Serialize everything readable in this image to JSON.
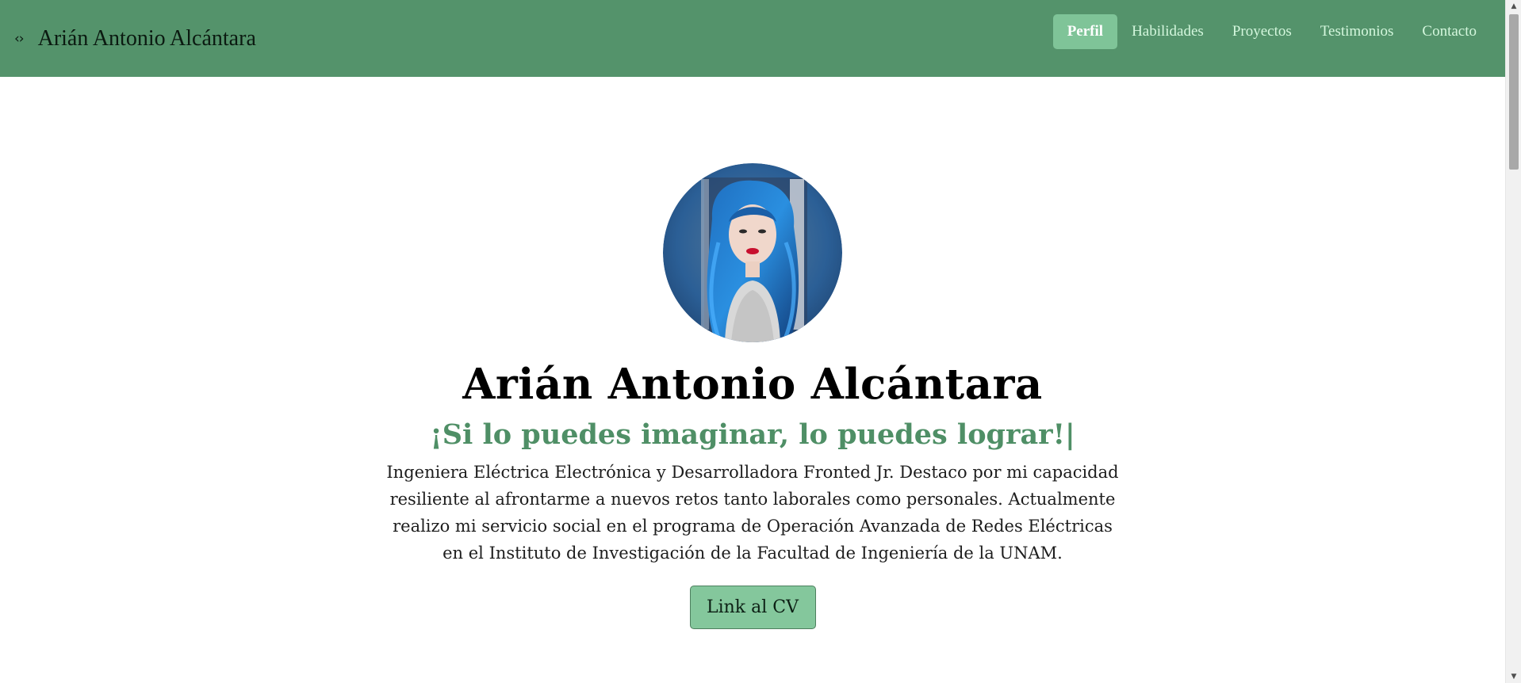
{
  "navbar": {
    "brand_icon": "‹›",
    "brand_name": "Arián Antonio Alcántara",
    "links": [
      {
        "label": "Perfil",
        "active": true
      },
      {
        "label": "Habilidades",
        "active": false
      },
      {
        "label": "Proyectos",
        "active": false
      },
      {
        "label": "Testimonios",
        "active": false
      },
      {
        "label": "Contacto",
        "active": false
      }
    ]
  },
  "hero": {
    "name": "Arián Antonio Alcántara",
    "tagline": "¡Si lo puedes imaginar, lo puedes lograr!",
    "tagline_cursor": "|",
    "bio": "Ingeniera Eléctrica Electrónica y Desarrolladora Fronted Jr. Destaco por mi capacidad resiliente al afrontarme a nuevos retos tanto laborales como personales. Actualmente realizo mi servicio social en el programa de Operación Avanzada de Redes Eléctricas en el Instituto de Investigación de la Facultad de Ingeniería de la UNAM.",
    "cv_button": "Link al CV"
  },
  "icons": {
    "brand": "code-brackets-icon",
    "scroll_up": "triangle-up-icon",
    "scroll_down": "triangle-down-icon"
  },
  "colors": {
    "navbar_bg": "#54936b",
    "nav_active_bg": "#7fc498",
    "nav_link": "#d4f7dd",
    "tagline": "#4f8f66",
    "cv_button_bg": "#84c79c"
  }
}
